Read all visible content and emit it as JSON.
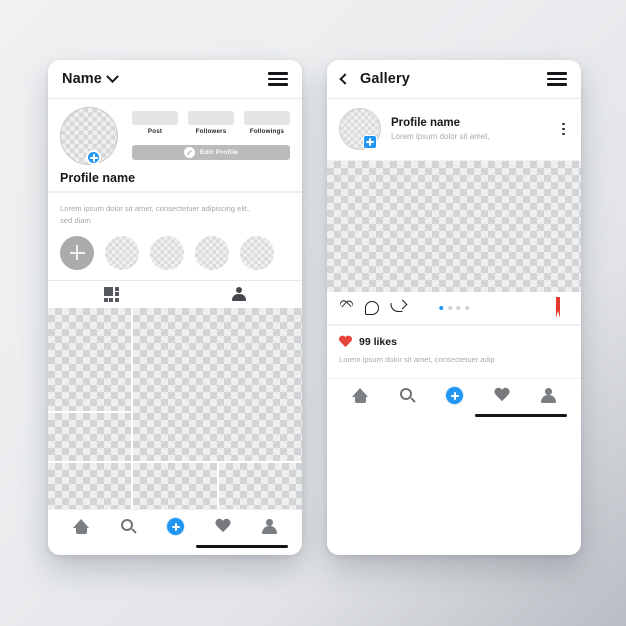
{
  "theme": {
    "accent_blue": "#2196f3",
    "heart_red": "#e8443c",
    "bookmark_red": "#e5392f",
    "text_dark": "#16181c",
    "text_muted": "#a7aaae",
    "placeholder_gray": "#b9bbbd"
  },
  "left_screen": {
    "header": {
      "title": "Name",
      "chevron_icon": "chevron-down-icon",
      "menu_icon": "hamburger-menu-icon"
    },
    "profile": {
      "avatar_icon": "profile-avatar-placeholder",
      "avatar_badge_icon": "add-story-plus-icon",
      "name": "Profile name",
      "stats": [
        {
          "label": "Post",
          "value": ""
        },
        {
          "label": "Followers",
          "value": ""
        },
        {
          "label": "Followings",
          "value": ""
        }
      ],
      "edit_button": {
        "label": "Edit Profile",
        "icon": "pencil-edit-icon"
      }
    },
    "bio": {
      "text": "Lorem ipsum dolor sit amet, consectetuer adipiscing elit, sed diam"
    },
    "highlights": {
      "add_label": "add-highlight-plus-icon",
      "items": [
        "highlight-1",
        "highlight-2",
        "highlight-3",
        "highlight-4"
      ]
    },
    "tabs": [
      {
        "name": "grid-tab",
        "icon": "grid-layout-icon",
        "active": true
      },
      {
        "name": "tagged-tab",
        "icon": "person-tagged-icon",
        "active": false
      }
    ],
    "photo_grid": {
      "cells": [
        "photo-1",
        "photo-2",
        "photo-3",
        "photo-4",
        "photo-5",
        "photo-6",
        "photo-7"
      ]
    },
    "bottom_nav": [
      {
        "name": "home",
        "icon": "home-icon"
      },
      {
        "name": "search",
        "icon": "search-icon"
      },
      {
        "name": "create",
        "icon": "plus-circle-icon"
      },
      {
        "name": "activity",
        "icon": "heart-filled-icon"
      },
      {
        "name": "profile",
        "icon": "person-icon"
      }
    ]
  },
  "right_screen": {
    "header": {
      "back_icon": "chevron-left-icon",
      "title": "Gallery",
      "menu_icon": "hamburger-menu-icon"
    },
    "post": {
      "avatar_icon": "post-avatar-placeholder",
      "avatar_badge_icon": "add-story-plus-icon",
      "name": "Profile name",
      "subtitle": "Lorem ipsum dolor sit amet,",
      "more_icon": "kebab-menu-icon",
      "image_icon": "post-image-placeholder",
      "actions": [
        {
          "name": "like",
          "icon": "heart-outline-icon"
        },
        {
          "name": "comment",
          "icon": "comment-bubble-icon"
        },
        {
          "name": "share",
          "icon": "share-arrow-icon"
        }
      ],
      "carousel_dots": {
        "count": 4,
        "active_index": 0
      },
      "save_icon": "bookmark-icon",
      "likes_icon": "heart-filled-red-icon",
      "likes_text": "99 likes",
      "caption": "Lorem ipsum dolor sit amet, consectetuer adip"
    },
    "bottom_nav": [
      {
        "name": "home",
        "icon": "home-icon"
      },
      {
        "name": "search",
        "icon": "search-icon"
      },
      {
        "name": "create",
        "icon": "plus-circle-icon"
      },
      {
        "name": "activity",
        "icon": "heart-filled-icon"
      },
      {
        "name": "profile",
        "icon": "person-icon"
      }
    ]
  }
}
